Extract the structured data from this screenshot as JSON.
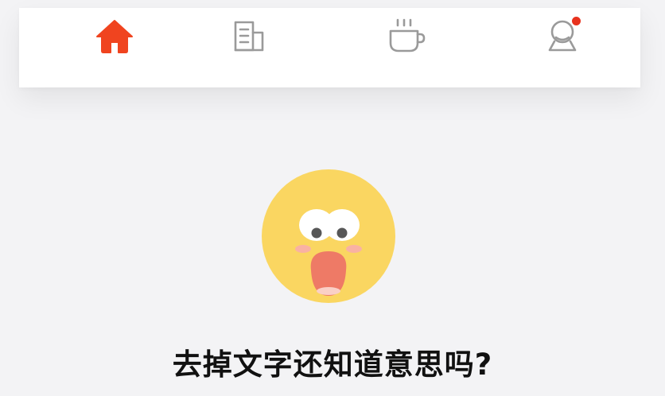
{
  "tabbar": {
    "items": [
      {
        "icon": "home-icon",
        "active": true,
        "color": "#f0441f"
      },
      {
        "icon": "news-icon",
        "active": false,
        "color": "#9a9a9a"
      },
      {
        "icon": "tea-cup-icon",
        "active": false,
        "color": "#9a9a9a"
      },
      {
        "icon": "profile-icon",
        "active": false,
        "color": "#9a9a9a",
        "has_badge": true,
        "badge_color": "#e8321e"
      }
    ]
  },
  "illustration": {
    "icon": "shocked-face-emoji",
    "face_color": "#fad661"
  },
  "headline": "去掉文字还知道意思吗?"
}
